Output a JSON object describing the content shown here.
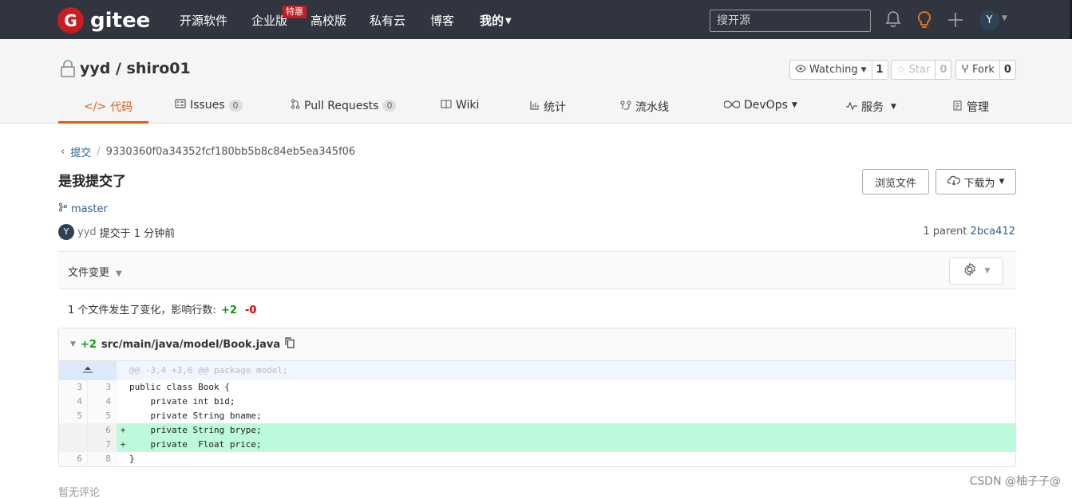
{
  "topnav": {
    "logo_mark": "G",
    "logo_text": "gitee",
    "items": [
      {
        "label": "开源软件"
      },
      {
        "label": "企业版"
      },
      {
        "label": "高校版"
      },
      {
        "label": "私有云"
      },
      {
        "label": "博客"
      },
      {
        "label": "我的"
      }
    ],
    "hot_badge": "特惠",
    "search_placeholder": "搜开源",
    "avatar_letter": "Y",
    "icons": [
      "bell-icon",
      "lightbulb-icon",
      "plus-icon"
    ]
  },
  "repo": {
    "name": "yyd / shiro01",
    "watch": {
      "label": "Watching",
      "count": "1"
    },
    "star": {
      "label": "Star",
      "count": "0"
    },
    "fork": {
      "label": "Fork",
      "count": "0"
    },
    "tabs": [
      {
        "label": "代码",
        "active": true
      },
      {
        "label": "Issues",
        "count": "0"
      },
      {
        "label": "Pull Requests",
        "count": "0"
      },
      {
        "label": "Wiki"
      },
      {
        "label": "统计"
      },
      {
        "label": "流水线"
      },
      {
        "label": "DevOps"
      },
      {
        "label": "服务"
      },
      {
        "label": "管理"
      }
    ]
  },
  "commit": {
    "breadcrumb_link": "提交",
    "hash": "9330360f0a34352fcf180bb5b8c84eb5ea345f06",
    "title": "是我提交了",
    "browse_button": "浏览文件",
    "download_button": "下载为",
    "branch": "master",
    "author_avatar": "Y",
    "author": "yyd",
    "time_text": "提交于 1 分钟前",
    "parent_label": "1 parent",
    "parent_hash": "2bca412"
  },
  "files": {
    "bar_label": "文件变更",
    "summary": "1 个文件发生了变化，影响行数:",
    "additions": "+2",
    "deletions": "-0",
    "diff": {
      "added": "+2",
      "path": "src/main/java/model/Book.java",
      "hunk": "@@ -3,4 +3,6 @@ package model;",
      "lines": [
        {
          "old": "3",
          "new": "3",
          "sign": "",
          "code": "public class Book {",
          "type": "ctx"
        },
        {
          "old": "4",
          "new": "4",
          "sign": "",
          "code": "    private int bid;",
          "type": "ctx"
        },
        {
          "old": "5",
          "new": "5",
          "sign": "",
          "code": "    private String bname;",
          "type": "ctx"
        },
        {
          "old": "",
          "new": "6",
          "sign": "+",
          "code": "    private String brype;",
          "type": "add"
        },
        {
          "old": "",
          "new": "7",
          "sign": "+",
          "code": "    private  Float price;",
          "type": "add"
        },
        {
          "old": "6",
          "new": "8",
          "sign": "",
          "code": "}",
          "type": "ctx"
        }
      ]
    }
  },
  "comments_text": "暂无评论",
  "watermark": "CSDN @柚子子@"
}
